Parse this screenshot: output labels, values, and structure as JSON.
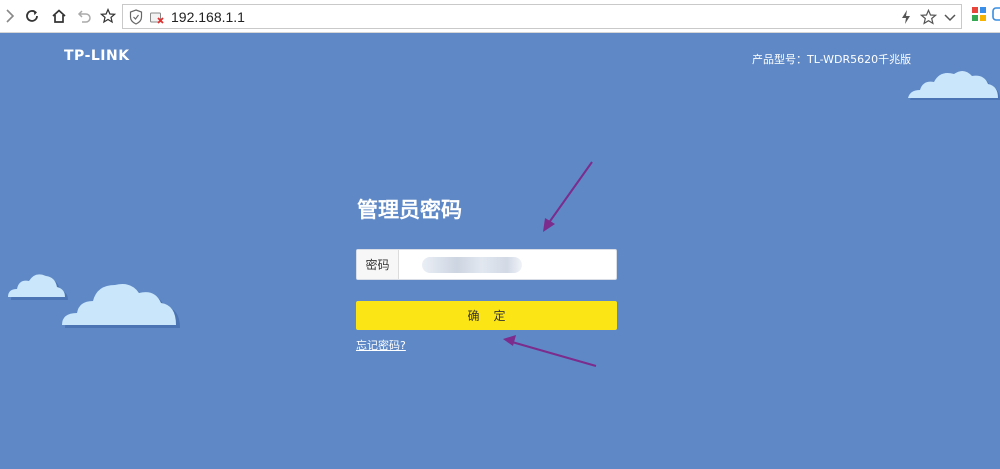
{
  "browser": {
    "url": "192.168.1.1"
  },
  "header": {
    "brand": "TP-LINK",
    "model": "产品型号：TL-WDR5620千兆版"
  },
  "login": {
    "title": "管理员密码",
    "password_label": "密码",
    "confirm_label": "确定",
    "forgot_link": "忘记密码?"
  },
  "colors": {
    "page_background": "#5f88c6",
    "confirm_button": "#fbe515",
    "annotation_arrow": "#7b2c8c",
    "cloud_light": "#c9e6fb",
    "cloud_shadow": "#4a74b4"
  }
}
